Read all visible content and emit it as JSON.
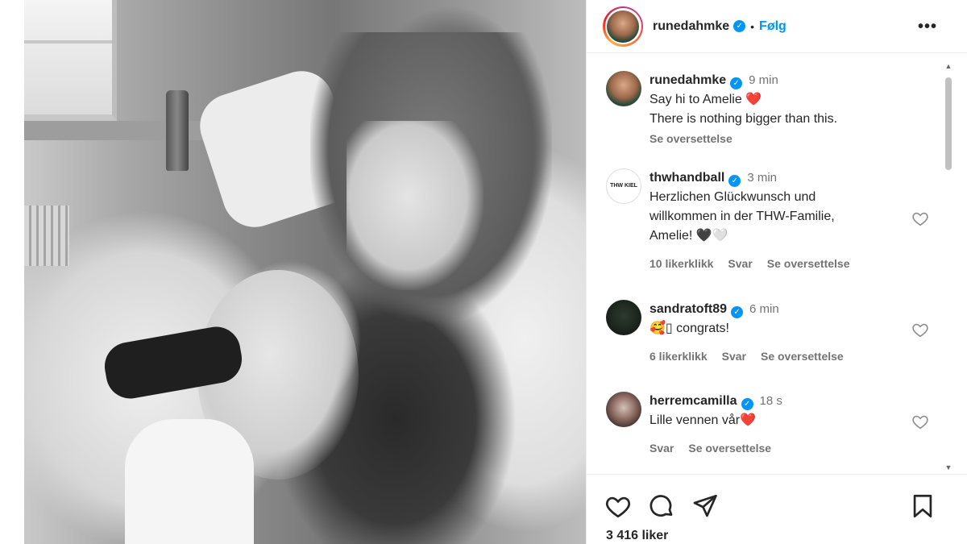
{
  "post": {
    "author": "runedahmke",
    "follow_label": "Følg",
    "separator": "•",
    "more_label": "•••"
  },
  "comments": [
    {
      "user": "runedahmke",
      "time": "9 min",
      "lines": [
        "Say hi to Amelie ❤️",
        "There is nothing bigger than this."
      ],
      "translate": "Se oversettelse"
    },
    {
      "user": "thwhandball",
      "time": "3 min",
      "avatar_text": "THW KIEL",
      "lines": [
        "Herzlichen Glückwunsch und",
        "willkommen in der THW-Familie,",
        "Amelie! 🖤🤍"
      ],
      "likes": "10 likerklikk",
      "reply": "Svar",
      "translate": "Se oversettelse"
    },
    {
      "user": "sandratoft89",
      "time": "6 min",
      "lines": [
        "🥰▯ congrats!"
      ],
      "likes": "6 likerklikk",
      "reply": "Svar",
      "translate": "Se oversettelse"
    },
    {
      "user": "herremcamilla",
      "time": "18 s",
      "lines": [
        "Lille vennen vår❤️"
      ],
      "reply": "Svar",
      "translate": "Se oversettelse"
    }
  ],
  "footer": {
    "likes": "3 416 liker"
  },
  "icons": {
    "verified": "verified-badge-icon",
    "like": "heart-icon",
    "comment": "comment-bubble-icon",
    "share": "paper-plane-icon",
    "save": "bookmark-icon"
  },
  "colors": {
    "accent": "#0095f6",
    "text": "#262626",
    "muted": "#737373"
  }
}
